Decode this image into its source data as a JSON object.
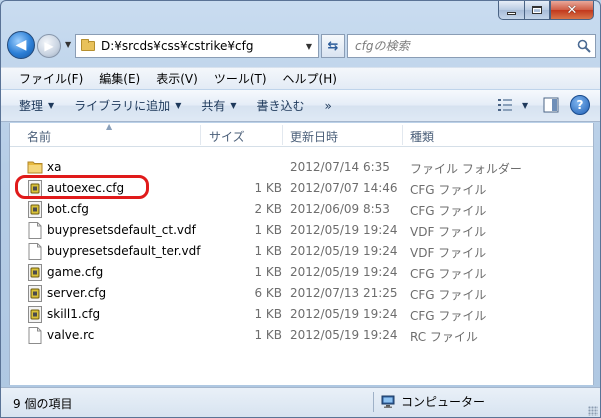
{
  "address": {
    "path": "D:¥srcds¥css¥cstrike¥cfg"
  },
  "search": {
    "placeholder": "cfgの検索"
  },
  "menu": [
    "ファイル(F)",
    "編集(E)",
    "表示(V)",
    "ツール(T)",
    "ヘルプ(H)"
  ],
  "toolbar": {
    "organize": "整理",
    "library": "ライブラリに追加",
    "share": "共有",
    "burn": "書き込む",
    "more": "»"
  },
  "columns": {
    "name": "名前",
    "size": "サイズ",
    "date": "更新日時",
    "type": "種類"
  },
  "files": [
    {
      "name": "xa",
      "size": "",
      "date": "2012/07/14 6:35",
      "type": "ファイル フォルダー",
      "icon": "folder-icon"
    },
    {
      "name": "autoexec.cfg",
      "size": "1 KB",
      "date": "2012/07/07 14:46",
      "type": "CFG ファイル",
      "icon": "cfg-file-icon"
    },
    {
      "name": "bot.cfg",
      "size": "2 KB",
      "date": "2012/06/09 8:53",
      "type": "CFG ファイル",
      "icon": "cfg-file-icon"
    },
    {
      "name": "buypresetsdefault_ct.vdf",
      "size": "1 KB",
      "date": "2012/05/19 19:24",
      "type": "VDF ファイル",
      "icon": "blank-file-icon"
    },
    {
      "name": "buypresetsdefault_ter.vdf",
      "size": "1 KB",
      "date": "2012/05/19 19:24",
      "type": "VDF ファイル",
      "icon": "blank-file-icon"
    },
    {
      "name": "game.cfg",
      "size": "1 KB",
      "date": "2012/05/19 19:24",
      "type": "CFG ファイル",
      "icon": "cfg-file-icon"
    },
    {
      "name": "server.cfg",
      "size": "6 KB",
      "date": "2012/07/13 21:25",
      "type": "CFG ファイル",
      "icon": "cfg-file-icon"
    },
    {
      "name": "skill1.cfg",
      "size": "1 KB",
      "date": "2012/05/19 19:24",
      "type": "CFG ファイル",
      "icon": "cfg-file-icon"
    },
    {
      "name": "valve.rc",
      "size": "1 KB",
      "date": "2012/05/19 19:24",
      "type": "RC ファイル",
      "icon": "blank-file-icon"
    }
  ],
  "status": {
    "count": "9 個の項目",
    "location": "コンピューター"
  },
  "colors": {
    "highlight_ring": "#e01a1a",
    "window_frame": "#b6cde6"
  }
}
